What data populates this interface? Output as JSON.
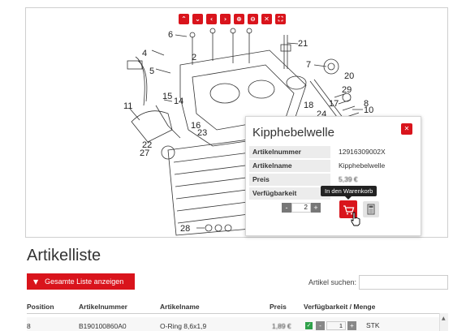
{
  "diagram": {
    "toolbar": [
      {
        "name": "move-up-icon",
        "glyph": "⌃"
      },
      {
        "name": "move-down-icon",
        "glyph": "⌄"
      },
      {
        "name": "move-left-icon",
        "glyph": "‹"
      },
      {
        "name": "move-right-icon",
        "glyph": "›"
      },
      {
        "name": "zoom-in-icon",
        "glyph": "⊕"
      },
      {
        "name": "zoom-out-icon",
        "glyph": "⊖"
      },
      {
        "name": "reset-icon",
        "glyph": "✕"
      },
      {
        "name": "fullscreen-icon",
        "glyph": "⛶"
      }
    ],
    "labels": [
      "6",
      "21",
      "4",
      "2",
      "5",
      "7",
      "20",
      "29",
      "17",
      "8",
      "10",
      "11",
      "15",
      "14",
      "18",
      "24",
      "16",
      "23",
      "22",
      "27",
      "28"
    ]
  },
  "popup": {
    "title": "Kipphebelwelle",
    "close_icon": "close-icon",
    "fields": [
      {
        "label": "Artikelnummer",
        "value": "12916309002X"
      },
      {
        "label": "Artikelname",
        "value": "Kipphebelwelle"
      },
      {
        "label": "Preis",
        "value": "5,39 €"
      },
      {
        "label": "Verfügbarkeit",
        "value": ""
      }
    ],
    "qty_minus": "-",
    "qty_plus": "+",
    "quantity": "2",
    "tooltip": "In den Warenkorb",
    "cart_icon": "cart-icon",
    "calc_icon": "calculator-icon"
  },
  "list": {
    "title": "Artikelliste",
    "show_all_label": "Gesamte Liste anzeigen",
    "search_label": "Artikel suchen:",
    "search_value": "",
    "columns": [
      "Position",
      "Artikelnummer",
      "Artikelname",
      "Preis",
      "Verfügbarkeit / Menge"
    ],
    "rows": [
      {
        "position": "8",
        "artikelnummer": "B190100860A0",
        "artikelname": "O-Ring 8,6x1,9",
        "preis": "1,89 €",
        "quantity": "1",
        "unit": "STK",
        "minus": "-",
        "plus": "+"
      }
    ]
  },
  "colors": {
    "accent": "#d9141c",
    "available": "#2fa14a"
  }
}
